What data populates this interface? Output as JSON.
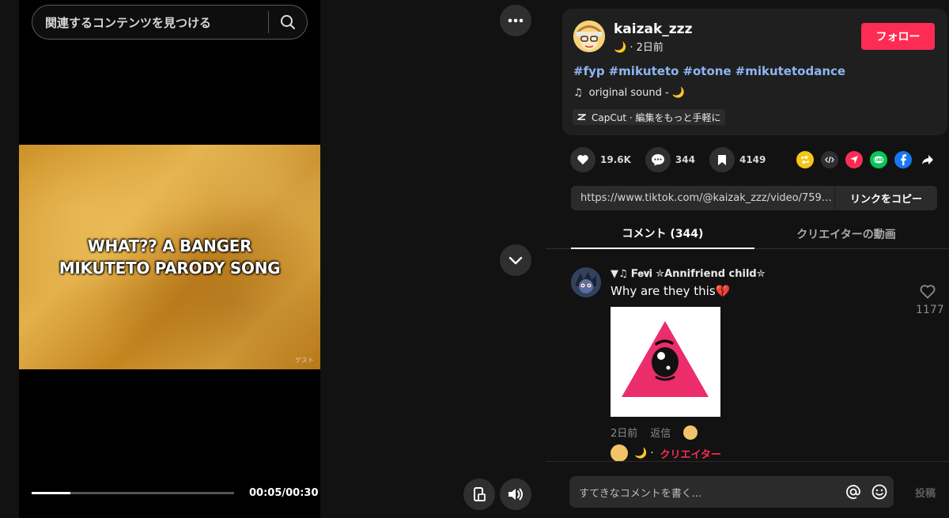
{
  "search": {
    "placeholder": "関連するコンテンツを見つける"
  },
  "video": {
    "caption_line1": "WHAT?? A BANGER",
    "caption_line2": "MIKUTETO PARODY SONG",
    "watermark": "ゲスト",
    "time": "00:05/00:30",
    "progress_fraction": 0.19
  },
  "author": {
    "name": "kaizak_zzz",
    "moon": "🌙",
    "posted": "· 2日前",
    "follow_label": "フォロー"
  },
  "description": {
    "hashtags": [
      "#fyp",
      "#mikuteto",
      "#otone",
      "#mikutetodance"
    ],
    "music_icon": "♫",
    "music": "original sound - 🌙",
    "capcut": "CapCut · 編集をもっと手軽に"
  },
  "actions": {
    "likes": "19.6K",
    "comments": "344",
    "bookmarks": "4149"
  },
  "share": {
    "link": "https://www.tiktok.com/@kaizak_zzz/video/75970...",
    "copy_label": "リンクをコピー"
  },
  "tabs": {
    "comments": "コメント (344)",
    "creator_videos": "クリエイターの動画"
  },
  "comment": {
    "user": "▼♫ 𝐅𝐞𝐯𝐢 ✮Annifriend child✮",
    "text": "Why are they this💔",
    "like_count": "1177",
    "date": "2日前",
    "reply_label": "返信",
    "creator_prefix": "🌙 · ",
    "creator_label": "クリエイター"
  },
  "composer": {
    "placeholder": "すてきなコメントを書く...",
    "post_label": "投稿"
  },
  "colors": {
    "accent": "#fe2c55",
    "hashtag": "#8fb6f2",
    "background": "#121212"
  }
}
